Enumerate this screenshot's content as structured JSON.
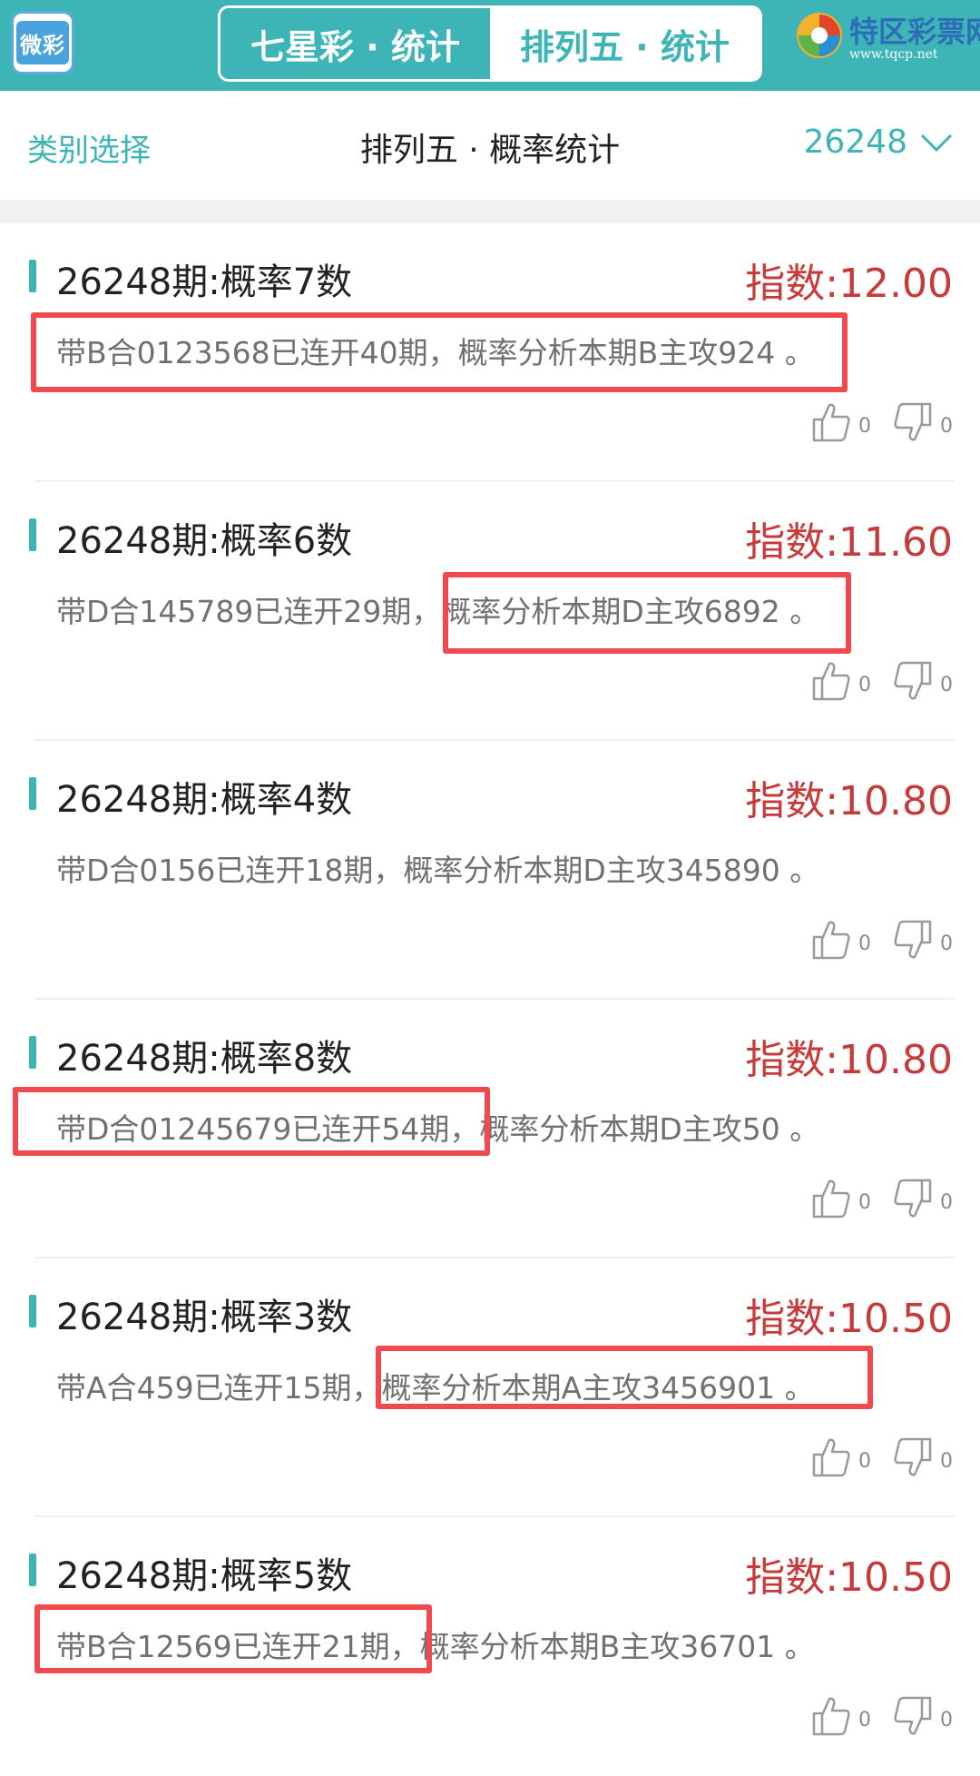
{
  "header": {
    "app_logo_text": "微彩",
    "tabs": [
      {
        "label": "七星彩 · 统计",
        "active": false
      },
      {
        "label": "排列五 · 统计",
        "active": true
      }
    ],
    "brand_name": "特区彩票网",
    "brand_url": "www.tqcp.net"
  },
  "subheader": {
    "category_label": "类别选择",
    "title": "排列五 · 概率统计",
    "period_selector": "26248"
  },
  "colors": {
    "primary": "#3db5b6",
    "index_red": "#c83a3a",
    "highlight_box": "#f04a4f"
  },
  "items": [
    {
      "title": "26248期:概率7数",
      "index": "指数:12.00",
      "desc": "带B合0123568已连开40期，概率分析本期B主攻924 。",
      "likes": "0",
      "dislikes": "0"
    },
    {
      "title": "26248期:概率6数",
      "index": "指数:11.60",
      "desc": "带D合145789已连开29期，概率分析本期D主攻6892 。",
      "likes": "0",
      "dislikes": "0"
    },
    {
      "title": "26248期:概率4数",
      "index": "指数:10.80",
      "desc": "带D合0156已连开18期，概率分析本期D主攻345890 。",
      "likes": "0",
      "dislikes": "0"
    },
    {
      "title": "26248期:概率8数",
      "index": "指数:10.80",
      "desc": "带D合01245679已连开54期，概率分析本期D主攻50 。",
      "likes": "0",
      "dislikes": "0"
    },
    {
      "title": "26248期:概率3数",
      "index": "指数:10.50",
      "desc": "带A合459已连开15期，概率分析本期A主攻3456901 。",
      "likes": "0",
      "dislikes": "0"
    },
    {
      "title": "26248期:概率5数",
      "index": "指数:10.50",
      "desc": "带B合12569已连开21期，概率分析本期B主攻36701 。",
      "likes": "0",
      "dislikes": "0"
    }
  ]
}
